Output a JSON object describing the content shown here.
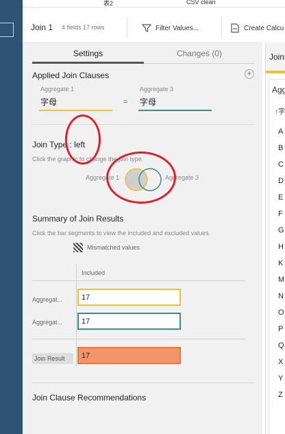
{
  "topbar": {
    "tab1": "表2",
    "tab2": "CSV clean"
  },
  "toolbar": {
    "title": "Join 1",
    "meta": "4 fields  17 rows",
    "filter_label": "Filter Values...",
    "calc_label": "Create Calcu"
  },
  "tabs": {
    "settings": "Settings",
    "changes": "Changes (0)"
  },
  "clauses": {
    "heading": "Applied Join Clauses",
    "left_label": "Aggregate 1",
    "left_value": "字母",
    "operator": "=",
    "right_label": "Aggregate 3",
    "right_value": "字母"
  },
  "join_type": {
    "heading": "Join Type : left",
    "hint": "Click the graphic to change the join type.",
    "left_label": "Aggregate 1",
    "right_label": "Aggregate 3"
  },
  "summary": {
    "heading": "Summary of Join Results",
    "hint": "Click the bar segments to view the included and excluded values.",
    "legend": "Mismatched values",
    "column": "Included",
    "rows": [
      {
        "label": "Aggregat...",
        "value": "17"
      },
      {
        "label": "Aggregat...",
        "value": "17"
      }
    ],
    "result_label": "Join Result",
    "result_value": "17"
  },
  "recommendations": {
    "heading": "Join Clause Recommendations"
  },
  "right_panel": {
    "tab": "Join",
    "title": "Aggr",
    "sort": "↑字",
    "letters": [
      "A",
      "B",
      "C",
      "D",
      "E",
      "F",
      "G",
      "H",
      "K",
      "M",
      "N",
      "O",
      "P",
      "Q",
      "X",
      "Y",
      "Z"
    ]
  },
  "colors": {
    "left": "#f0c232",
    "right": "#3d8c84",
    "result": "#f3956c",
    "annotation": "#e0202a"
  }
}
